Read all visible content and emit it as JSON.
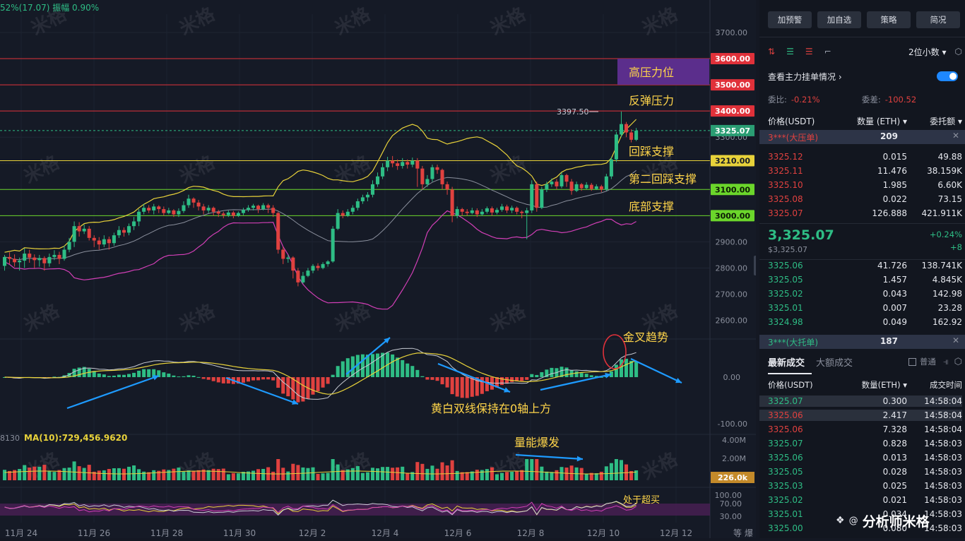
{
  "header": {
    "stats": "52%(17.07)  振幅 0.90%"
  },
  "watermark": "米格",
  "signature": "分析师米格",
  "chart_data": {
    "type": "candlestick",
    "price_axis": {
      "ticks": [
        "3700.00",
        "3600.00",
        "3500.00",
        "3400.00",
        "3325.07",
        "3300.00",
        "3210.00",
        "3100.00",
        "3000.00",
        "2900.00",
        "2800.00",
        "2700.00",
        "2600.00"
      ],
      "ylim": [
        2600,
        3700
      ]
    },
    "date_ticks": [
      "11月 24",
      "11月 26",
      "11月 28",
      "11月 30",
      "12月 2",
      "12月 4",
      "12月 6",
      "12月 8",
      "12月 10",
      "12月 12"
    ],
    "levels": [
      {
        "price": 3600,
        "label": "3600.00",
        "color": "#e0313a"
      },
      {
        "price": 3500,
        "label": "3500.00",
        "color": "#e0313a"
      },
      {
        "price": 3400,
        "label": "3400.00",
        "color": "#e0313a"
      },
      {
        "price": 3210,
        "label": "3210.00",
        "color": "#e8d23a"
      },
      {
        "price": 3100,
        "label": "3100.00",
        "color": "#6bd62b"
      },
      {
        "price": 3000,
        "label": "3000.00",
        "color": "#6bd62b"
      }
    ],
    "current_price": {
      "label": "3325.07",
      "value": 3325.07
    },
    "high_marker": {
      "label": "3397.50",
      "value": 3397.5
    },
    "annotations": [
      "高压力位",
      "反弹压力",
      "回踩支撑",
      "第二回踩支撑",
      "底部支撑",
      "金叉趋势",
      "黄白双线保持在0轴上方",
      "量能爆发",
      "处于超买"
    ],
    "candles": [
      [
        2808,
        2842,
        2790,
        2850
      ],
      [
        2842,
        2835,
        2815,
        2860
      ],
      [
        2835,
        2822,
        2805,
        2852
      ],
      [
        2822,
        2828,
        2790,
        2840
      ],
      [
        2828,
        2855,
        2800,
        2875
      ],
      [
        2855,
        2840,
        2820,
        2870
      ],
      [
        2840,
        2830,
        2800,
        2852
      ],
      [
        2830,
        2838,
        2805,
        2850
      ],
      [
        2838,
        2818,
        2790,
        2845
      ],
      [
        2818,
        2842,
        2805,
        2855
      ],
      [
        2842,
        2850,
        2830,
        2868
      ],
      [
        2850,
        2835,
        2815,
        2862
      ],
      [
        2835,
        2870,
        2828,
        2885
      ],
      [
        2870,
        2900,
        2860,
        2915
      ],
      [
        2900,
        2960,
        2880,
        2978
      ],
      [
        2960,
        2940,
        2920,
        2975
      ],
      [
        2940,
        2950,
        2930,
        2966
      ],
      [
        2950,
        2915,
        2905,
        2960
      ],
      [
        2915,
        2905,
        2880,
        2925
      ],
      [
        2905,
        2890,
        2870,
        2918
      ],
      [
        2890,
        2910,
        2880,
        2925
      ],
      [
        2910,
        2895,
        2870,
        2920
      ],
      [
        2895,
        2925,
        2885,
        2935
      ],
      [
        2925,
        2945,
        2915,
        2960
      ],
      [
        2945,
        2935,
        2920,
        2955
      ],
      [
        2935,
        2960,
        2925,
        2970
      ],
      [
        2960,
        2978,
        2945,
        2995
      ],
      [
        2978,
        3015,
        2960,
        3025
      ],
      [
        3015,
        3030,
        3005,
        3045
      ],
      [
        3030,
        3020,
        3010,
        3040
      ],
      [
        3020,
        3035,
        3005,
        3045
      ],
      [
        3035,
        3025,
        3010,
        3040
      ],
      [
        3025,
        3010,
        3000,
        3035
      ],
      [
        3010,
        3020,
        3005,
        3030
      ],
      [
        3020,
        3005,
        2995,
        3025
      ],
      [
        3005,
        3018,
        2995,
        3028
      ],
      [
        3018,
        3040,
        3010,
        3055
      ],
      [
        3040,
        3065,
        3030,
        3080
      ],
      [
        3065,
        3050,
        3030,
        3070
      ],
      [
        3050,
        3035,
        3020,
        3060
      ],
      [
        3035,
        3020,
        3005,
        3045
      ],
      [
        3020,
        3030,
        3010,
        3040
      ],
      [
        3030,
        3015,
        3000,
        3035
      ],
      [
        3015,
        3008,
        2995,
        3022
      ],
      [
        3008,
        3002,
        2990,
        3015
      ],
      [
        3002,
        3012,
        2995,
        3020
      ],
      [
        3012,
        3000,
        2990,
        3018
      ],
      [
        3000,
        3010,
        2995,
        3016
      ],
      [
        3010,
        3022,
        3002,
        3030
      ],
      [
        3022,
        3030,
        3015,
        3040
      ],
      [
        3030,
        3038,
        3020,
        3045
      ],
      [
        3038,
        3025,
        3010,
        3042
      ],
      [
        3025,
        3040,
        3020,
        3048
      ],
      [
        3040,
        3030,
        3010,
        3046
      ],
      [
        3030,
        3010,
        2995,
        3040
      ],
      [
        3010,
        2870,
        2855,
        3015
      ],
      [
        2870,
        2835,
        2815,
        2880
      ],
      [
        2835,
        2840,
        2820,
        2850
      ],
      [
        2840,
        2790,
        2760,
        2845
      ],
      [
        2790,
        2745,
        2730,
        2800
      ],
      [
        2745,
        2770,
        2740,
        2785
      ],
      [
        2770,
        2790,
        2765,
        2800
      ],
      [
        2790,
        2808,
        2780,
        2815
      ],
      [
        2808,
        2800,
        2790,
        2818
      ],
      [
        2800,
        2815,
        2795,
        2822
      ],
      [
        2815,
        2825,
        2805,
        2830
      ],
      [
        2825,
        2950,
        2820,
        2960
      ],
      [
        2950,
        3010,
        2945,
        3025
      ],
      [
        3010,
        3000,
        2990,
        3020
      ],
      [
        3000,
        3015,
        2995,
        3025
      ],
      [
        3015,
        3030,
        3005,
        3040
      ],
      [
        3030,
        3055,
        3020,
        3065
      ],
      [
        3055,
        3070,
        3045,
        3080
      ],
      [
        3070,
        3080,
        3055,
        3090
      ],
      [
        3080,
        3120,
        3070,
        3135
      ],
      [
        3120,
        3150,
        3110,
        3165
      ],
      [
        3150,
        3185,
        3140,
        3200
      ],
      [
        3185,
        3210,
        3170,
        3225
      ],
      [
        3210,
        3200,
        3185,
        3228
      ],
      [
        3200,
        3190,
        3175,
        3215
      ],
      [
        3190,
        3205,
        3180,
        3220
      ],
      [
        3205,
        3195,
        3180,
        3215
      ],
      [
        3195,
        3210,
        3185,
        3222
      ],
      [
        3210,
        3180,
        3110,
        3220
      ],
      [
        3180,
        3120,
        3100,
        3190
      ],
      [
        3120,
        3140,
        3110,
        3155
      ],
      [
        3140,
        3185,
        3130,
        3195
      ],
      [
        3185,
        3175,
        3160,
        3195
      ],
      [
        3175,
        3120,
        3100,
        3180
      ],
      [
        3120,
        3100,
        3080,
        3130
      ],
      [
        3100,
        3000,
        2975,
        3110
      ],
      [
        3000,
        3025,
        2990,
        3035
      ],
      [
        3025,
        3015,
        3000,
        3030
      ],
      [
        3015,
        3010,
        3000,
        3025
      ],
      [
        3010,
        3020,
        3005,
        3030
      ],
      [
        3020,
        3005,
        2995,
        3028
      ],
      [
        3005,
        3015,
        3000,
        3025
      ],
      [
        3015,
        3028,
        3008,
        3035
      ],
      [
        3028,
        3012,
        3000,
        3035
      ],
      [
        3012,
        3022,
        3005,
        3030
      ],
      [
        3022,
        3035,
        3015,
        3045
      ],
      [
        3035,
        3020,
        3010,
        3042
      ],
      [
        3020,
        3030,
        3010,
        3038
      ],
      [
        3030,
        3015,
        3005,
        3035
      ],
      [
        3015,
        3010,
        2990,
        3020
      ],
      [
        3010,
        3020,
        2910,
        3030
      ],
      [
        3020,
        3120,
        3010,
        3135
      ],
      [
        3120,
        3030,
        3015,
        3130
      ],
      [
        3030,
        3100,
        3025,
        3110
      ],
      [
        3100,
        3120,
        3090,
        3130
      ],
      [
        3120,
        3130,
        3110,
        3142
      ],
      [
        3130,
        3112,
        3100,
        3140
      ],
      [
        3112,
        3155,
        3105,
        3165
      ],
      [
        3155,
        3130,
        3110,
        3160
      ],
      [
        3130,
        3095,
        3080,
        3140
      ],
      [
        3095,
        3120,
        3090,
        3130
      ],
      [
        3120,
        3105,
        3095,
        3125
      ],
      [
        3105,
        3118,
        3100,
        3128
      ],
      [
        3118,
        3102,
        3095,
        3125
      ],
      [
        3102,
        3112,
        3098,
        3120
      ],
      [
        3112,
        3100,
        3090,
        3118
      ],
      [
        3100,
        3150,
        3095,
        3160
      ],
      [
        3150,
        3215,
        3140,
        3225
      ],
      [
        3215,
        3310,
        3205,
        3320
      ],
      [
        3310,
        3350,
        3300,
        3398
      ],
      [
        3350,
        3318,
        3300,
        3358
      ],
      [
        3318,
        3290,
        3280,
        3330
      ],
      [
        3290,
        3325,
        3285,
        3335
      ]
    ],
    "macd": {
      "zero_label": "0.00",
      "lower_label": "-100.00"
    },
    "volume": {
      "left_label": "8130",
      "ma_label": "MA(10):729,456.9620",
      "ticks": [
        "4.00M",
        "2.00M"
      ],
      "current": "226.0k"
    },
    "rsi": {
      "ticks": [
        "100.00",
        "70.00",
        "30.00"
      ]
    },
    "corner_labels": [
      "等",
      "爆"
    ]
  },
  "sidebar": {
    "buttons": [
      "加预警",
      "加自选",
      "策略",
      "简况"
    ],
    "precision": "2位小数",
    "orders_link": "查看主力挂单情况",
    "ratio_label": "委比:",
    "ratio_value": "-0.21%",
    "diff_label": "委差:",
    "diff_value": "-100.52",
    "cols": [
      "价格(USDT)",
      "数量 (ETH)",
      "委托额"
    ],
    "big_sell": {
      "name": "3***(大压单)",
      "qty": "209"
    },
    "asks": [
      [
        "3325.12",
        "0.015",
        "49.88"
      ],
      [
        "3325.11",
        "11.476",
        "38.159K"
      ],
      [
        "3325.10",
        "1.985",
        "6.60K"
      ],
      [
        "3325.08",
        "0.022",
        "73.15"
      ],
      [
        "3325.07",
        "126.888",
        "421.911K"
      ]
    ],
    "last_price": "3,325.07",
    "last_sub": "$3,325.07",
    "change_pct": "+0.24%",
    "change_abs": "+8",
    "bids": [
      [
        "3325.06",
        "41.726",
        "138.741K"
      ],
      [
        "3325.05",
        "1.457",
        "4.845K"
      ],
      [
        "3325.02",
        "0.043",
        "142.98"
      ],
      [
        "3325.01",
        "0.007",
        "23.28"
      ],
      [
        "3324.98",
        "0.049",
        "162.92"
      ]
    ],
    "big_buy": {
      "name": "3***(大托单)",
      "qty": "187"
    },
    "trades_tab": "最新成交",
    "trades_tab2": "大额成交",
    "trades_mode": "普通",
    "trade_cols": [
      "价格(USDT)",
      "数量(ETH)",
      "成交时间"
    ],
    "trades": [
      [
        "3325.07",
        "0.300",
        "14:58:04",
        "g"
      ],
      [
        "3325.06",
        "2.417",
        "14:58:04",
        "r"
      ],
      [
        "3325.06",
        "7.328",
        "14:58:04",
        "r"
      ],
      [
        "3325.07",
        "0.828",
        "14:58:03",
        "g"
      ],
      [
        "3325.06",
        "0.013",
        "14:58:03",
        "g"
      ],
      [
        "3325.05",
        "0.028",
        "14:58:03",
        "g"
      ],
      [
        "3325.03",
        "0.025",
        "14:58:03",
        "g"
      ],
      [
        "3325.02",
        "0.021",
        "14:58:03",
        "g"
      ],
      [
        "3325.01",
        "0.034",
        "14:58:03",
        "g"
      ],
      [
        "3325.00",
        "0.080",
        "14:58:03",
        "g"
      ]
    ]
  }
}
